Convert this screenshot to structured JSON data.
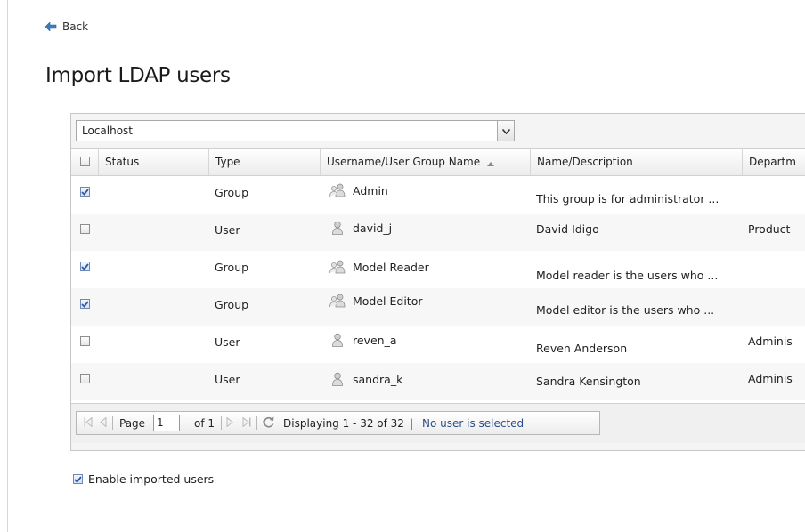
{
  "nav": {
    "back_label": "Back"
  },
  "page": {
    "title": "Import LDAP users"
  },
  "source": {
    "selected": "Localhost"
  },
  "grid": {
    "columns": [
      "Status",
      "Type",
      "Username/User Group Name",
      "Name/Description",
      "Departm"
    ],
    "sorted_column": "Username/User Group Name",
    "sort_direction": "ascending",
    "rows": [
      {
        "checked": true,
        "type": "Group",
        "icon": "group-icon",
        "name": "Admin",
        "description": "This group is for administrator ...",
        "department": ""
      },
      {
        "checked": false,
        "type": "User",
        "icon": "user-icon",
        "name": "david_j",
        "description": "David Idigo",
        "department": "Product"
      },
      {
        "checked": true,
        "type": "Group",
        "icon": "group-icon",
        "name": "Model Reader",
        "description": "Model reader is the users who ...",
        "department": ""
      },
      {
        "checked": true,
        "type": "Group",
        "icon": "group-icon",
        "name": "Model Editor",
        "description": "Model editor is the users who ...",
        "department": ""
      },
      {
        "checked": false,
        "type": "User",
        "icon": "user-icon",
        "name": "reven_a",
        "description": "Reven Anderson",
        "department": "Adminis"
      },
      {
        "checked": false,
        "type": "User",
        "icon": "user-icon",
        "name": "sandra_k",
        "description": "Sandra Kensington",
        "department": "Adminis"
      }
    ]
  },
  "pager": {
    "page_label": "Page",
    "page_value": "1",
    "of_label": "of 1",
    "display_text": "Displaying 1 - 32 of 32",
    "divider": "|",
    "selection_text": "No user is selected"
  },
  "options": {
    "enable_label": "Enable imported users",
    "enable_checked": true
  },
  "colors": {
    "back_arrow": "#3b7bc6",
    "check": "#2e59a8",
    "link": "#2a4e8a"
  }
}
